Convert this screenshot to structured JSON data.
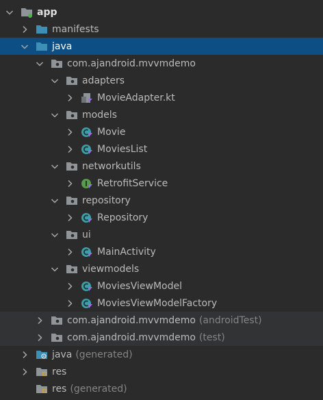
{
  "tree": {
    "app": "app",
    "manifests": "manifests",
    "java": "java",
    "pkg_main": "com.ajandroid.mvvmdemo",
    "adapters": "adapters",
    "movie_adapter": "MovieAdapter.kt",
    "models": "models",
    "movie": "Movie",
    "movies_list": "MoviesList",
    "networkutils": "networkutils",
    "retrofit_service": "RetrofitService",
    "repository": "repository",
    "repository_class": "Repository",
    "ui": "ui",
    "main_activity": "MainActivity",
    "viewmodels": "viewmodels",
    "movies_view_model": "MoviesViewModel",
    "movies_view_model_factory": "MoviesViewModelFactory",
    "pkg_android_test": "com.ajandroid.mvvmdemo",
    "pkg_android_test_suffix": "(androidTest)",
    "pkg_test": "com.ajandroid.mvvmdemo",
    "pkg_test_suffix": "(test)",
    "java_generated": "java",
    "java_generated_suffix": "(generated)",
    "res": "res",
    "res_generated": "res",
    "res_generated_suffix": "(generated)"
  },
  "colors": {
    "background": "#2b2b2b",
    "selection": "#0d4f85",
    "folder_blue": "#3d8fb6",
    "folder_gray": "#8f9499",
    "class_teal": "#3d9fa8",
    "interface_green": "#5a9a4c",
    "kotlin_marker": "#9b6fe0"
  }
}
